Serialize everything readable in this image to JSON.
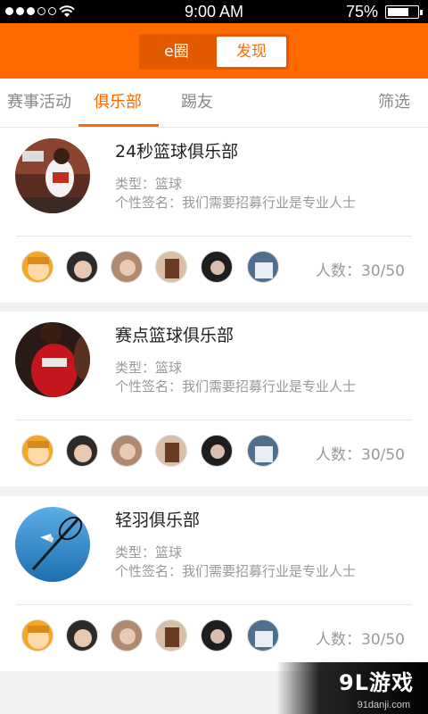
{
  "status": {
    "time": "9:00 AM",
    "battery": "75%",
    "battery_level": 0.75
  },
  "header": {
    "segments": [
      "e圈",
      "发现"
    ],
    "active_segment": "发现"
  },
  "tabs": {
    "items": [
      "赛事活动",
      "俱乐部",
      "踢友"
    ],
    "active": "俱乐部",
    "filter": "筛选"
  },
  "clubs": [
    {
      "name": "24秒篮球俱乐部",
      "type": "类型：篮球",
      "signature": "个性签名：我们需要招募行业是专业人士",
      "count": "人数：30/50"
    },
    {
      "name": "赛点篮球俱乐部",
      "type": "类型：篮球",
      "signature": "个性签名：我们需要招募行业是专业人士",
      "count": "人数：30/50"
    },
    {
      "name": "轻羽俱乐部",
      "type": "类型：篮球",
      "signature": "个性签名：我们需要招募行业是专业人士",
      "count": "人数：30/50"
    }
  ],
  "watermark": {
    "main": "9L游戏",
    "sub": "91danji.com"
  },
  "colors": {
    "accent": "#ff6a00",
    "muted": "#999999"
  }
}
